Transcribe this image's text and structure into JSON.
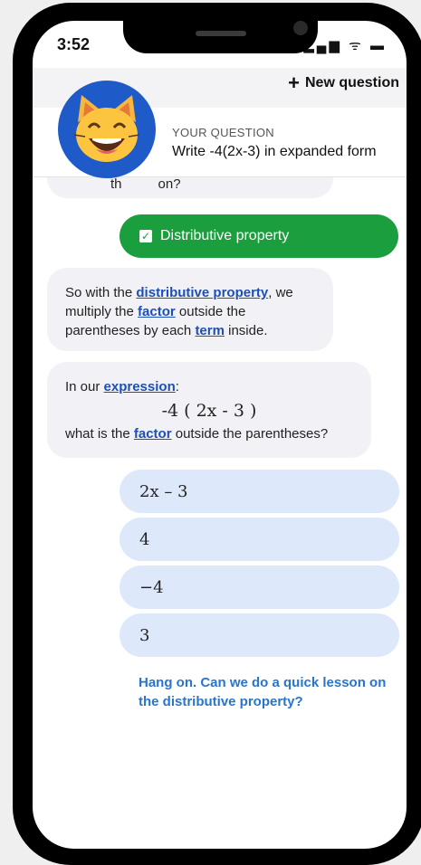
{
  "status": {
    "time": "3:52",
    "icons": "..ıl ᯤ ▬"
  },
  "header": {
    "new_question_label": "New question"
  },
  "question": {
    "label": "YOUR QUESTION",
    "text": "Write -4(2x-3) in expanded form"
  },
  "avatar": {
    "emoji": "😸"
  },
  "previous_bubble": {
    "visible_fragment": "th       on?"
  },
  "selected_answer": {
    "label": "Distributive property"
  },
  "explanation": {
    "parts": [
      "So with the ",
      "distributive property",
      ", we multiply the ",
      "factor",
      " outside the parentheses by each ",
      "term",
      " inside."
    ]
  },
  "prompt": {
    "intro": "In our ",
    "intro_link": "expression",
    "intro_suffix": ":",
    "expression": "-4 ( 2x - 3 )",
    "question_prefix": "what is the ",
    "question_link": "factor",
    "question_suffix": " outside the parentheses?"
  },
  "choices": [
    "2x – 3",
    "4",
    "−4",
    "3"
  ],
  "lesson_request": "Hang on. Can we do a quick lesson on the distributive property?",
  "colors": {
    "accent_green": "#1b9e3e",
    "link_blue": "#1d4fb8",
    "choice_bg": "#dde8fb",
    "avatar_bg": "#1e5bc8"
  }
}
